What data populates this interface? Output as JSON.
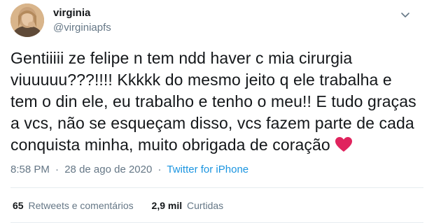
{
  "author": {
    "display_name": "virginia",
    "handle": "@virginiapfs"
  },
  "tweet": {
    "text": "Gentiiiii ze felipe n tem ndd haver c mia cirurgia viuuuuu???!!!! Kkkkk do mesmo jeito q ele trabalha e tem o din ele, eu trabalho e tenho o meu!! E tudo graças a vcs, não se esqueçam disso, vcs fazem parte de cada conquista minha, muito obrigada de coração",
    "emoji": "red-heart",
    "time": "8:58 PM",
    "separator": "·",
    "date": "28 de ago de 2020",
    "source": "Twitter for iPhone"
  },
  "stats": {
    "retweets_count": "65",
    "retweets_label": "Retweets e comentários",
    "likes_count": "2,9 mil",
    "likes_label": "Curtidas"
  },
  "icons": {
    "caret": "chevron-down-icon",
    "avatar": "profile-photo"
  },
  "colors": {
    "text": "#14171a",
    "secondary": "#657786",
    "link": "#1b95e0",
    "divider": "#e6ecf0",
    "heart": "#e0245e"
  }
}
